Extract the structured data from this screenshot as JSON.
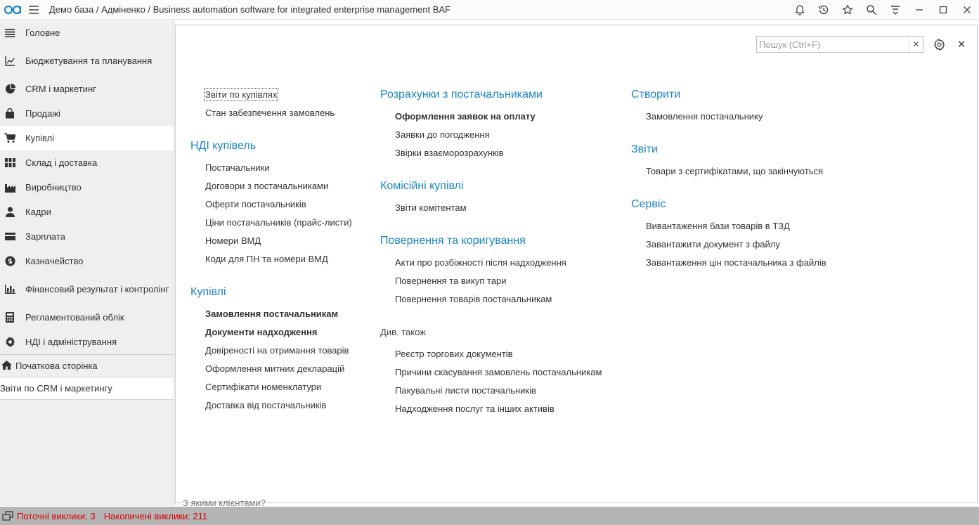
{
  "titlebar": {
    "title": "Демо база / Адміненко / Business automation software for integrated enterprise management BAF",
    "tools": [
      "bell-icon",
      "history-icon",
      "star-icon",
      "search-icon",
      "settings-list-icon",
      "minimize-icon",
      "maximize-icon",
      "close-icon"
    ]
  },
  "sidebar": {
    "items": [
      {
        "label": "Головне",
        "icon": "menu-icon"
      },
      {
        "label": "Бюджетування та планування",
        "icon": "chart-line-icon"
      },
      {
        "label": "CRM і маркетинг",
        "icon": "pie-chart-icon"
      },
      {
        "label": "Продажі",
        "icon": "shopping-bag-icon"
      },
      {
        "label": "Купівлі",
        "icon": "cart-icon"
      },
      {
        "label": "Склад і доставка",
        "icon": "warehouse-grid-icon"
      },
      {
        "label": "Виробництво",
        "icon": "factory-icon"
      },
      {
        "label": "Кадри",
        "icon": "person-icon"
      },
      {
        "label": "Зарплата",
        "icon": "card-icon"
      },
      {
        "label": "Казначейство",
        "icon": "coin-icon"
      },
      {
        "label": "Фінансовий результат і контролінг",
        "icon": "bar-chart-icon"
      },
      {
        "label": "Регламентований облік",
        "icon": "calculator-icon"
      },
      {
        "label": "НДІ і адміністрування",
        "icon": "gear-icon"
      }
    ],
    "home": "Початкова сторінка",
    "open_window": "Звіти по CRM і маркетингу"
  },
  "main": {
    "search_placeholder": "Пошук (Ctrl+F)",
    "col1": {
      "top_items": [
        "Звіти по купівлях",
        "Стан забезпечення замовлень"
      ],
      "ndi_title": "НДІ купівель",
      "ndi_items": [
        "Постачальники",
        "Договори з постачальниками",
        "Оферти постачальників",
        "Ціни постачальників (прайс-листи)",
        "Номери ВМД",
        "Коди для ПН та номери ВМД"
      ],
      "purchases_title": "Купівлі",
      "purchases_items": [
        "Замовлення постачальникам",
        "Документи надходження",
        "Довіреності на отримання товарів",
        "Оформлення митних декларацій",
        "Сертифікати номенклатури",
        "Доставка від постачальників"
      ]
    },
    "col2": {
      "settlements_title": "Розрахунки з постачальниками",
      "settlements_items": [
        "Оформлення заявок на оплату",
        "Заявки до погодження",
        "Звірки взаєморозрахунків"
      ],
      "commission_title": "Комісійні купівлі",
      "commission_items": [
        "Звіти комітентам"
      ],
      "returns_title": "Повернення та коригування",
      "returns_items": [
        "Акти про розбіжності після надходження",
        "Повернення та викуп тари",
        "Повернення товарів постачальникам"
      ],
      "see_also_title": "Див. також",
      "see_also_items": [
        "Реєстр торгових документів",
        "Причини скасування замовлень постачальникам",
        "Пакувальні листи постачальників",
        "Надходження послуг та інших активів"
      ]
    },
    "col3": {
      "create_title": "Створити",
      "create_items": [
        "Замовлення постачальнику"
      ],
      "reports_title": "Звіти",
      "reports_items": [
        "Товари з сертифікатами, що закінчуються"
      ],
      "service_title": "Сервіс",
      "service_items": [
        "Вивантаження бази товарів в ТЗД",
        "Завантажити документ з файлу",
        "Завантаження цін постачальника з файлів"
      ]
    }
  },
  "background_fragment": "З якими клієнтами?",
  "statusbar": {
    "current_calls": "Поточні виклики: 3",
    "accumulated_calls": "Накопичені виклики: 211"
  },
  "colors": {
    "accent_blue": "#1b85c3",
    "sidebar_bg": "#efefef",
    "status_red": "#d40000",
    "statusbar_bg": "#b5b5b5"
  }
}
